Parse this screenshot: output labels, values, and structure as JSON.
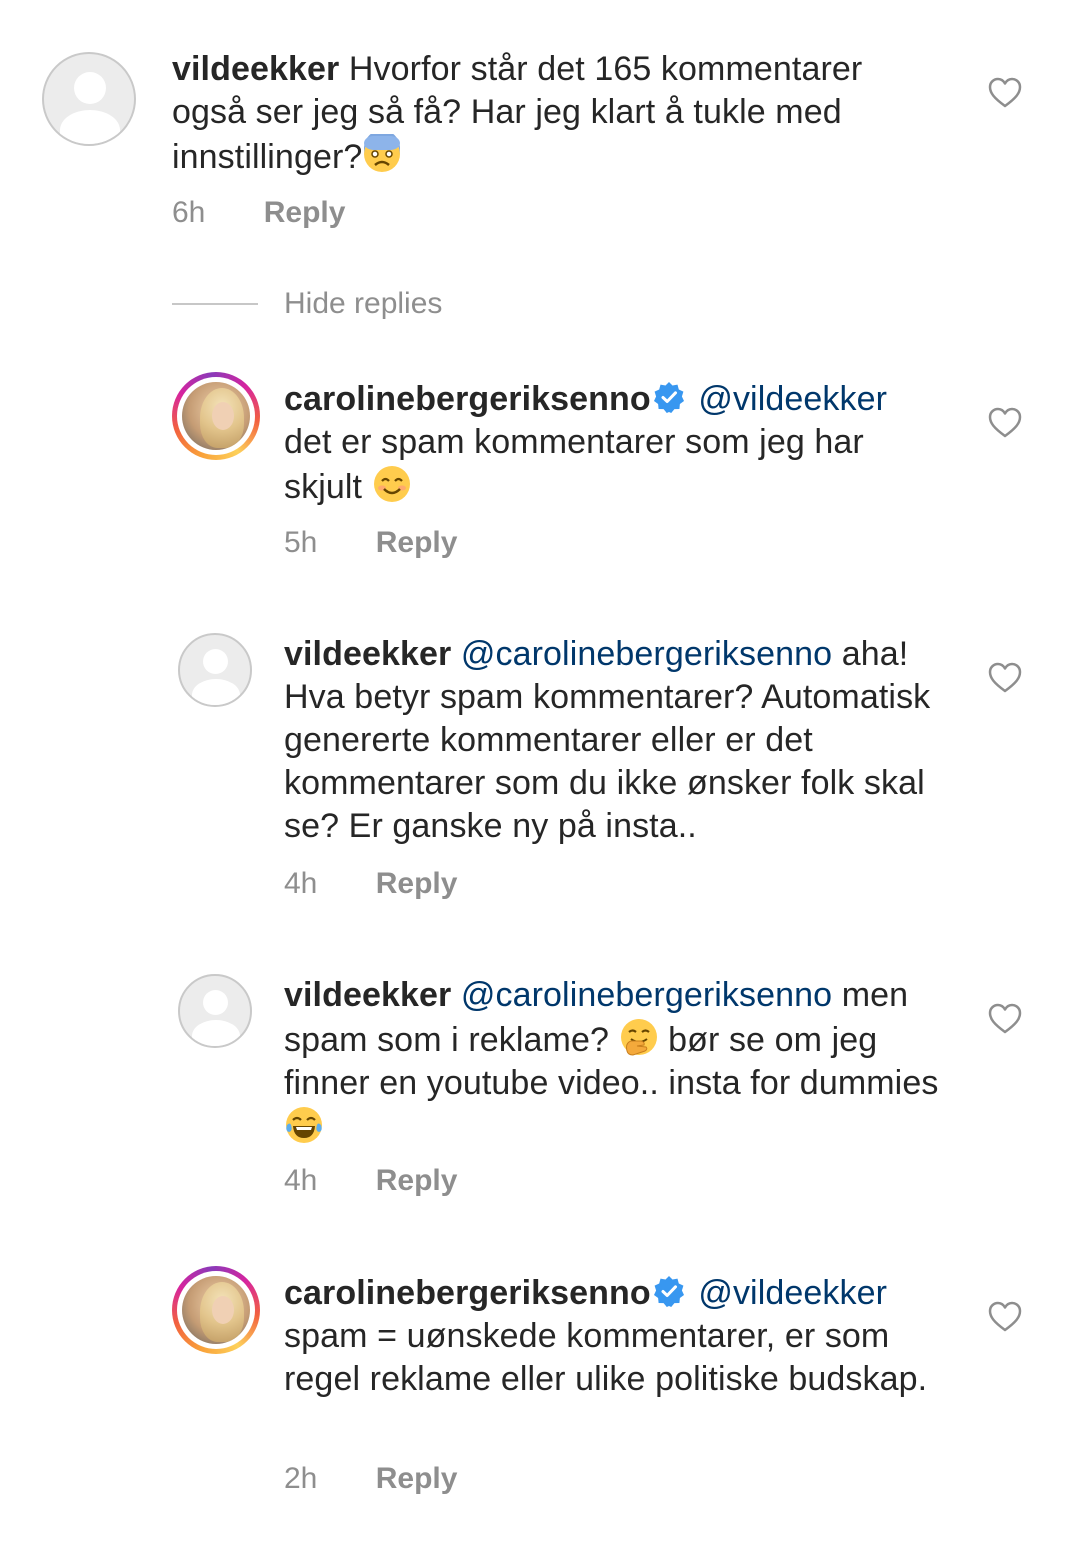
{
  "comments": [
    {
      "username": "vildeekker",
      "mention": "",
      "text": "Hvorfor står det 165 kommentarer også ser jeg så få? Har jeg klart å tukle med innstillinger?",
      "time": "6h",
      "reply_label": "Reply",
      "verified": false
    },
    {
      "username": "carolinebergeriksenno",
      "mention": "@vildeekker",
      "text": "det er spam kommentarer som jeg har skjult",
      "time": "5h",
      "reply_label": "Reply",
      "verified": true
    },
    {
      "username": "vildeekker",
      "mention": "@carolinebergeriksenno",
      "text": "aha! Hva betyr spam kommentarer? Automatisk genererte kommentarer eller er det kommentarer som du ikke ønsker folk skal se? Er ganske ny på insta..",
      "time": "4h",
      "reply_label": "Reply",
      "verified": false
    },
    {
      "username": "vildeekker",
      "mention": "@carolinebergeriksenno",
      "text_part1": "men spam som i reklame?",
      "text_part2": "bør se om jeg finner en youtube video.. insta for dummies",
      "time": "4h",
      "reply_label": "Reply",
      "verified": false
    },
    {
      "username": "carolinebergeriksenno",
      "mention": "@vildeekker",
      "text": "spam = uønskede kommentarer, er som regel reklame eller ulike politiske budskap.",
      "time": "2h",
      "reply_label": "Reply",
      "verified": true
    }
  ],
  "hide_replies_label": "Hide replies",
  "icons": {
    "like": "heart-outline-icon",
    "verified": "verified-badge-icon",
    "emoji_fearful": "fearful-face-emoji",
    "emoji_smile": "smiling-face-emoji",
    "emoji_hand_over_mouth": "face-with-hand-over-mouth-emoji",
    "emoji_tears_of_joy": "face-with-tears-of-joy-emoji"
  },
  "colors": {
    "text": "#262626",
    "secondary": "#8e8e8e",
    "mention": "#00376b",
    "verified": "#3897f0"
  }
}
